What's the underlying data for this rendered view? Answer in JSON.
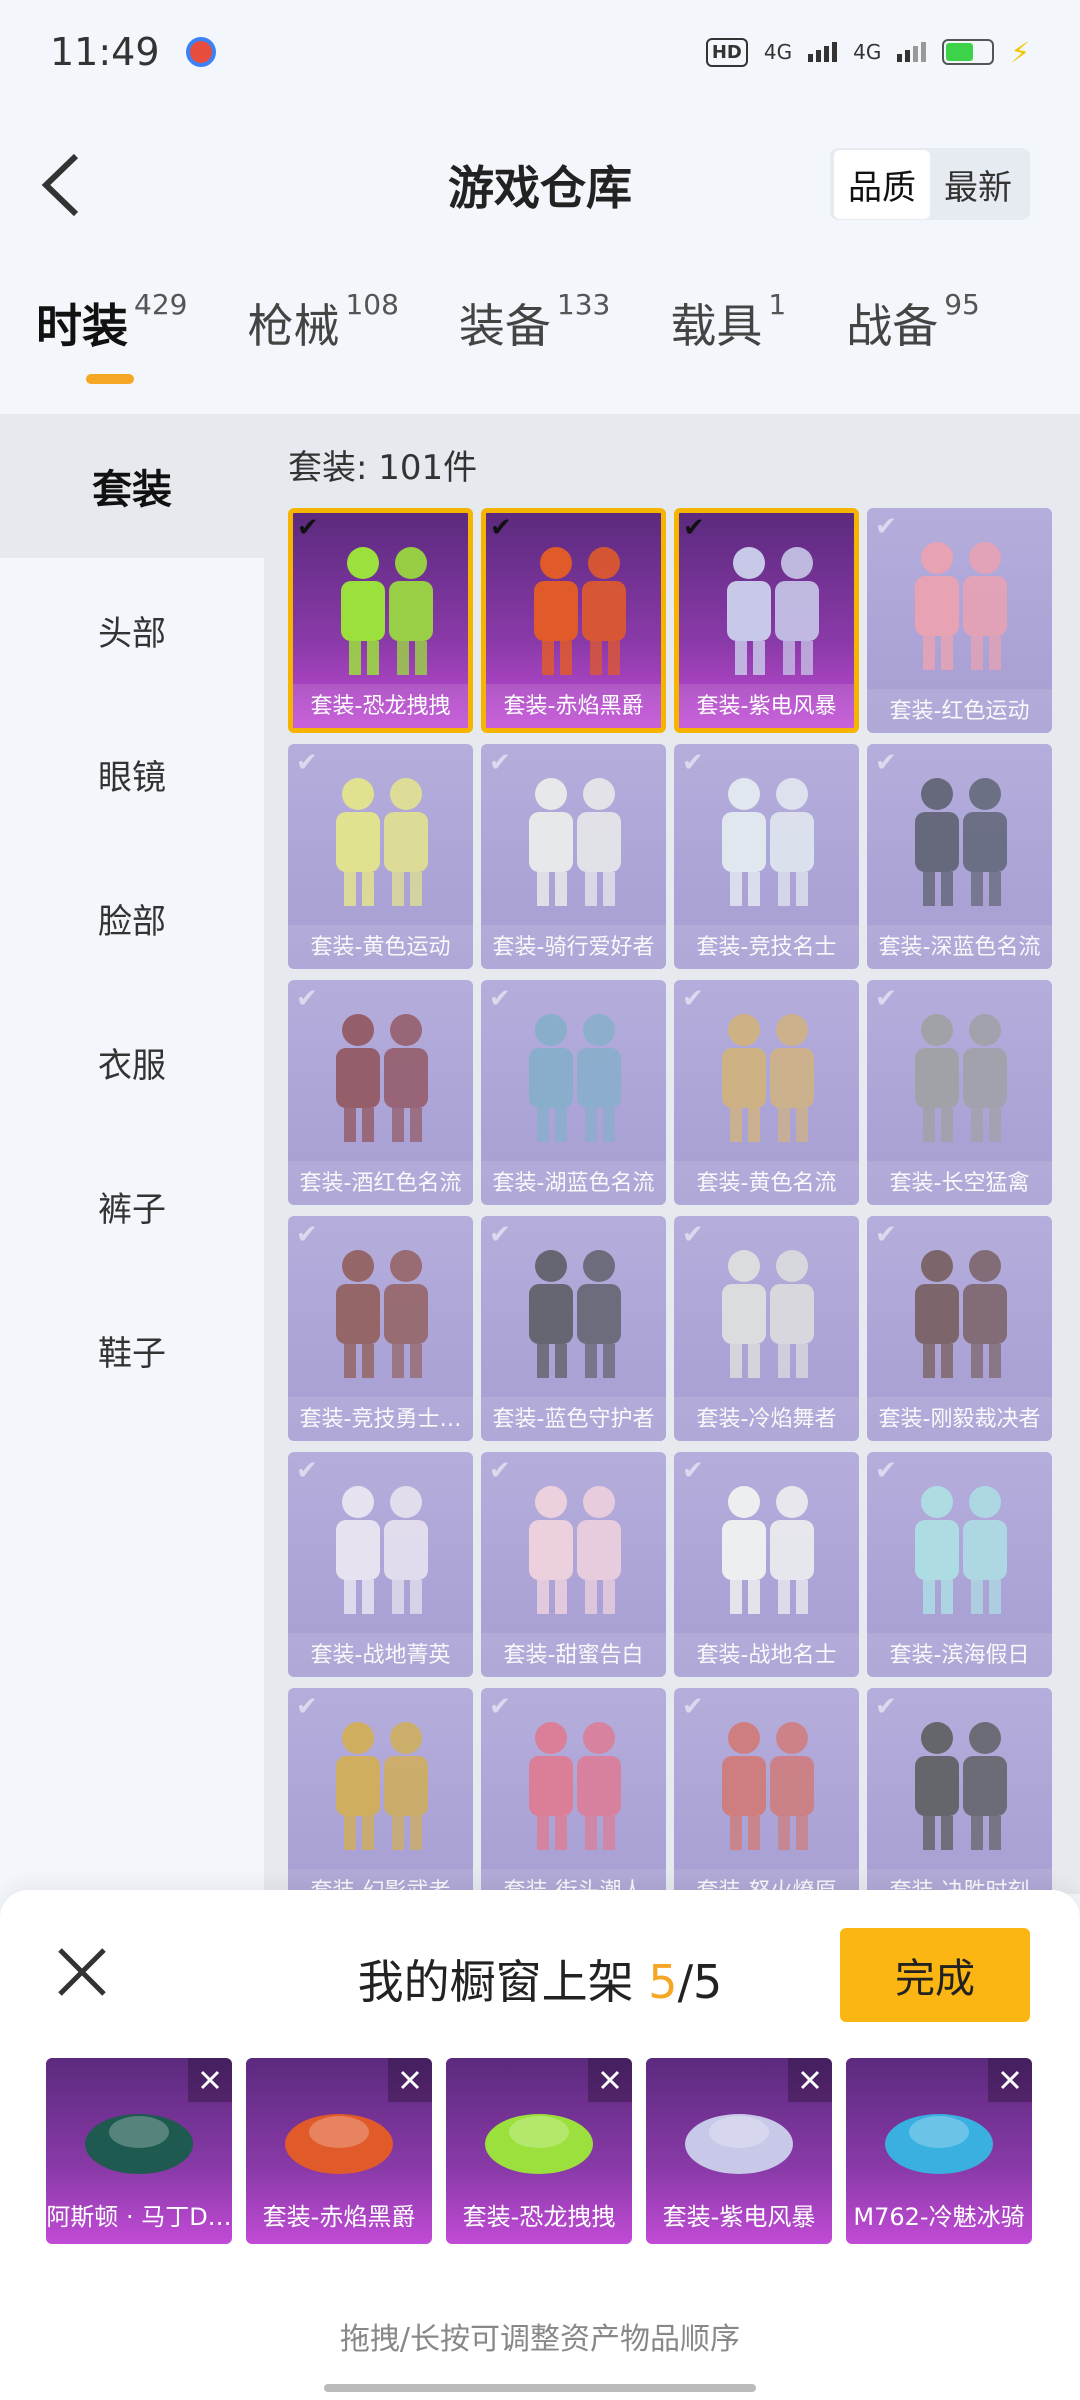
{
  "status": {
    "time": "11:49",
    "network": "4G",
    "hd": "HD"
  },
  "header": {
    "title": "游戏仓库",
    "sort": [
      "品质",
      "最新"
    ],
    "sort_active": 0
  },
  "tabs": [
    {
      "label": "时装",
      "count": "429"
    },
    {
      "label": "枪械",
      "count": "108"
    },
    {
      "label": "装备",
      "count": "133"
    },
    {
      "label": "载具",
      "count": "1"
    },
    {
      "label": "战备",
      "count": "95"
    }
  ],
  "sidebar": [
    "套装",
    "头部",
    "眼镜",
    "脸部",
    "衣服",
    "裤子",
    "鞋子"
  ],
  "content": {
    "count_label": "套装: 101件",
    "items": [
      {
        "name": "套装-恐龙拽拽",
        "selected": true,
        "color": "#9be03c"
      },
      {
        "name": "套装-赤焰黑爵",
        "selected": true,
        "color": "#e05a2a"
      },
      {
        "name": "套装-紫电风暴",
        "selected": true,
        "color": "#c8c8e8"
      },
      {
        "name": "套装-红色运动",
        "selected": false,
        "color": "#e88aa0"
      },
      {
        "name": "套装-黄色运动",
        "selected": false,
        "color": "#e0e070"
      },
      {
        "name": "套装-骑行爱好者",
        "selected": false,
        "color": "#e8e8e8"
      },
      {
        "name": "套装-竞技名士",
        "selected": false,
        "color": "#dfe6f0"
      },
      {
        "name": "套装-深蓝色名流",
        "selected": false,
        "color": "#3a3f55"
      },
      {
        "name": "套装-酒红色名流",
        "selected": false,
        "color": "#7a3040"
      },
      {
        "name": "套装-湖蓝色名流",
        "selected": false,
        "color": "#6a9ac0"
      },
      {
        "name": "套装-黄色名流",
        "selected": false,
        "color": "#c8a060"
      },
      {
        "name": "套装-长空猛禽",
        "selected": false,
        "color": "#8a8a90"
      },
      {
        "name": "套装-竞技勇士…",
        "selected": false,
        "color": "#7a3a3a"
      },
      {
        "name": "套装-蓝色守护者",
        "selected": false,
        "color": "#3a3a48"
      },
      {
        "name": "套装-冷焰舞者",
        "selected": false,
        "color": "#d8d8d8"
      },
      {
        "name": "套装-刚毅裁决者",
        "selected": false,
        "color": "#5a3a40"
      },
      {
        "name": "套装-战地菁英",
        "selected": false,
        "color": "#e8e0f0"
      },
      {
        "name": "套装-甜蜜告白",
        "selected": false,
        "color": "#f0c8d8"
      },
      {
        "name": "套装-战地名士",
        "selected": false,
        "color": "#f0f0f0"
      },
      {
        "name": "套装-滨海假日",
        "selected": false,
        "color": "#9ad8e0"
      },
      {
        "name": "套装-幻影武者",
        "selected": false,
        "color": "#c89a30"
      },
      {
        "name": "套装-街头潮人",
        "selected": false,
        "color": "#d85a7a"
      },
      {
        "name": "套装-怒火燎原",
        "selected": false,
        "color": "#c85a5a"
      },
      {
        "name": "套装-决胜时刻",
        "selected": false,
        "color": "#3a3a40"
      }
    ]
  },
  "sheet": {
    "title_prefix": "我的橱窗上架 ",
    "current": "5",
    "total": "/5",
    "done_label": "完成",
    "showcase": [
      {
        "name": "阿斯顿 · 马丁D…",
        "color": "#1e5a50"
      },
      {
        "name": "套装-赤焰黑爵",
        "color": "#e05a2a"
      },
      {
        "name": "套装-恐龙拽拽",
        "color": "#9be03c"
      },
      {
        "name": "套装-紫电风暴",
        "color": "#c8c8e8"
      },
      {
        "name": "M762-冷魅冰骑",
        "color": "#3ab0e0"
      }
    ],
    "hint": "拖拽/长按可调整资产物品顺序"
  }
}
